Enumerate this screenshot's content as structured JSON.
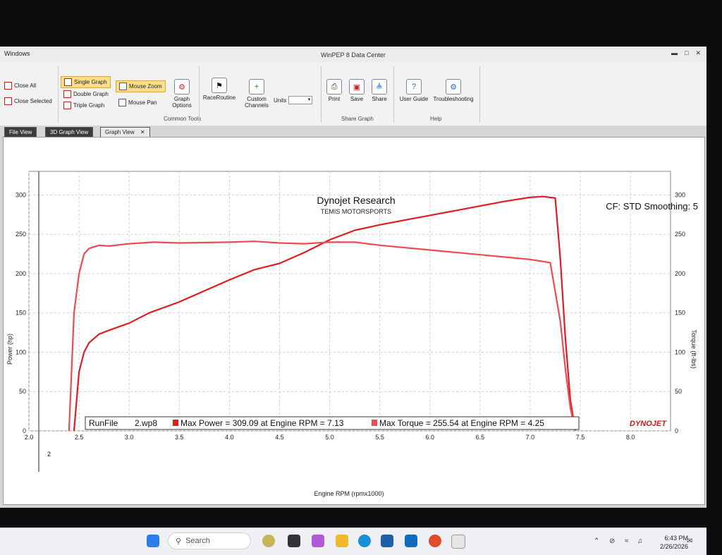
{
  "window": {
    "menu": "Windows",
    "title": "WinPEP 8 Data Center"
  },
  "ribbon": {
    "close_all": "Close All",
    "close_selected": "Close Selected",
    "single_graph": "Single Graph",
    "double_graph": "Double Graph",
    "triple_graph": "Triple Graph",
    "mouse_zoom": "Mouse Zoom",
    "mouse_pan": "Mouse Pan",
    "graph_options": "Graph Options",
    "common_tools": "Common Tools",
    "race_routine": "RaceRoutine",
    "custom_channels": "Custom Channels",
    "units": "Units",
    "print": "Print",
    "save": "Save",
    "share": "Share",
    "share_graph": "Share Graph",
    "user_guide": "User Guide",
    "troubleshooting": "Troubleshooting",
    "help": "Help"
  },
  "tabs": [
    {
      "label": "File View"
    },
    {
      "label": "3D Graph View"
    },
    {
      "label": "Graph View"
    }
  ],
  "graph": {
    "header_left": "Dynojet Research",
    "header_sub": "TEMIS MOTORSPORTS",
    "cf_text": "CF: STD Smoothing: 5",
    "legend": {
      "runfile_label": "RunFile",
      "runfile_value": "2.wp8",
      "max_power": "Max Power = 309.09 at Engine RPM = 7.13",
      "max_torque": "Max Torque = 255.54 at Engine RPM = 4.25"
    },
    "logo": "DYNOJET",
    "cursor_label": "2"
  },
  "chart_data": {
    "type": "line",
    "xlabel": "Engine RPM (rpmx1000)",
    "ylabel": "Power (hp)",
    "y2label": "Torque (ft-lbs)",
    "xlim": [
      2.0,
      8.4
    ],
    "ylim": [
      0,
      330
    ],
    "y2lim": [
      0,
      330
    ],
    "xticks": [
      2.0,
      2.5,
      3.0,
      3.5,
      4.0,
      4.5,
      5.0,
      5.5,
      6.0,
      6.5,
      7.0,
      7.5,
      8.0
    ],
    "yticks": [
      0,
      50,
      100,
      150,
      200,
      250,
      300
    ],
    "y2ticks": [
      0,
      50,
      100,
      150,
      200,
      250,
      300
    ],
    "grid": true,
    "colors": {
      "power": "#e01b22",
      "torque": "#ee4a50"
    },
    "series": [
      {
        "axis": "left",
        "x": [
          2.45,
          2.5,
          2.55,
          2.6,
          2.7,
          2.8,
          3.0,
          3.2,
          3.5,
          3.75,
          4.0,
          4.25,
          4.5,
          4.75,
          5.0,
          5.25,
          5.5,
          5.75,
          6.0,
          6.25,
          6.5,
          6.75,
          7.0,
          7.13,
          7.25,
          7.3,
          7.35,
          7.4,
          7.45
        ],
        "y": [
          0,
          75,
          100,
          112,
          123,
          128,
          137,
          150,
          164,
          178,
          192,
          205,
          213,
          227,
          243,
          255,
          262,
          268,
          274,
          280,
          286,
          292,
          297,
          298,
          296,
          220,
          120,
          40,
          0
        ]
      },
      {
        "axis": "right",
        "x": [
          2.4,
          2.45,
          2.5,
          2.55,
          2.6,
          2.7,
          2.8,
          3.0,
          3.25,
          3.5,
          4.0,
          4.25,
          4.5,
          4.75,
          5.0,
          5.25,
          5.5,
          6.0,
          6.5,
          7.0,
          7.2,
          7.3,
          7.35,
          7.4,
          7.45
        ],
        "y": [
          0,
          150,
          200,
          225,
          232,
          236,
          235,
          238,
          240,
          239,
          240,
          241,
          239,
          238,
          240,
          240,
          236,
          230,
          224,
          218,
          214,
          140,
          80,
          30,
          0
        ]
      }
    ]
  }
}
